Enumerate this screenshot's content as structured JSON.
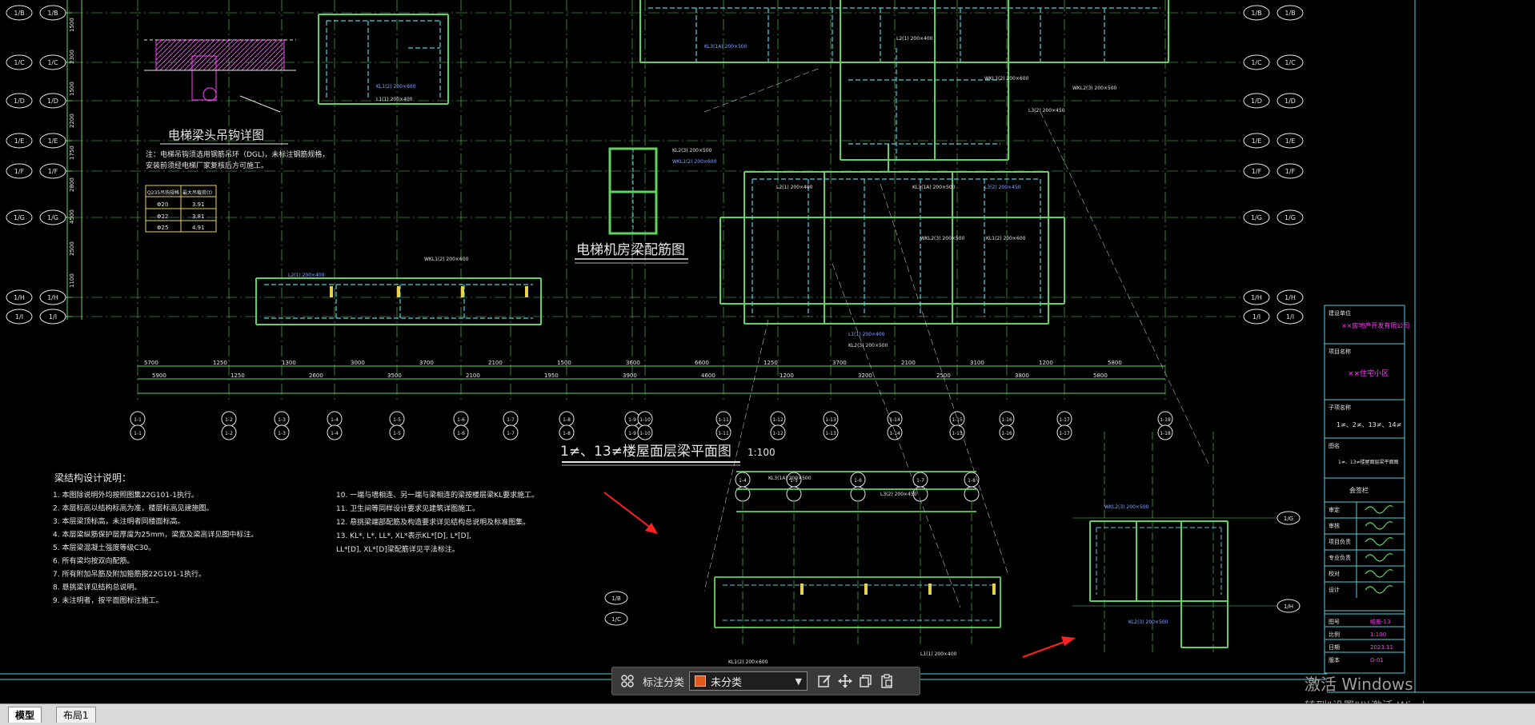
{
  "drawing": {
    "title_main": "1≠、13≠楼屋面层梁平面图",
    "title_scale": "1:100",
    "title_machine_room": "电梯机房梁配筋图",
    "title_elevator_detail": "电梯梁头吊钩详图",
    "note_detail_1": "注：电梯吊钩须选用钢筋吊环（DGL)，未标注钢筋规格，",
    "note_detail_2": "安装前须经电梯厂家复核后方可施工。",
    "rebar_table": {
      "headers": [
        "Q235吊钩规格",
        "最大吊载荷(t)"
      ],
      "rows": [
        [
          "Φ20",
          "3.91"
        ],
        [
          "Φ22",
          "3.81"
        ],
        [
          "Φ25",
          "4.91"
        ]
      ]
    },
    "notes_title": "梁结构设计说明：",
    "notes_left": [
      "1. 本图除说明外均按照图集22G101-1执行。",
      "2. 本层标高以结构标高为准，楼层标高见建施图。",
      "3. 本层梁顶标高，未注明者同楼面标高。",
      "4. 本层梁纵筋保护层厚度为25mm，梁宽及梁高详见图中标注。",
      "5. 本层梁混凝土强度等级C30。",
      "6. 所有梁均按双向配筋。",
      "7. 所有附加吊筋及附加箍筋按22G101-1执行。",
      "8. 悬挑梁详见结构总说明。",
      "9. 未注明者，按平面图标注施工。"
    ],
    "notes_right": [
      "10. 一端与墙相连、另一端与梁相连的梁按楼层梁KL要求施工。",
      "11. 卫生间等同样设计要求见建筑详图施工。",
      "12. 悬挑梁端部配筋及构造要求详见结构总说明及标准图集。",
      "13. KL*, L*, LL*, XL*表示KL*[D], L*[D],",
      "LL*[D], XL*[D]梁配筋详见平法标注。"
    ],
    "grid_right": [
      "1/B",
      "1/C",
      "1/D",
      "1/E",
      "1/F",
      "1/G",
      "1/H",
      "1/I"
    ],
    "grid_bottom": [
      "1-1",
      "1-2",
      "1-3",
      "1-4",
      "1-5",
      "1-6",
      "1-7",
      "1-8",
      "1-9",
      "1-10",
      "1-11",
      "1-12",
      "1-13",
      "1-14",
      "1-15",
      "1-16",
      "1-17",
      "1-18"
    ],
    "dims_bottom_row1": [
      "5700",
      "1250",
      "1300",
      "3000",
      "3700",
      "2100",
      "1500",
      "3600",
      "6600",
      "1250",
      "3700",
      "2100",
      "3100",
      "1200",
      "5800"
    ],
    "dims_bottom_row2": [
      "5900",
      "1250",
      "2600",
      "3500",
      "2100",
      "1950",
      "3900",
      "4600",
      "1200",
      "3200",
      "2500",
      "3800",
      "5800"
    ],
    "dims_left": [
      "1500",
      "2300",
      "1500",
      "2200",
      "1750",
      "2800",
      "4500",
      "2500",
      "1100"
    ],
    "beam_labels": [
      "KL1(2) 200×600",
      "L1(1) 200×400",
      "KL2(3) 200×500",
      "WKL1(2) 200×600",
      "L2(1) 200×400",
      "KL3(1A) 200×500",
      "L3(2) 200×450",
      "WKL2(3) 200×500"
    ]
  },
  "title_block": {
    "company_label": "建设单位",
    "company_value": "××房地产开发有限公司",
    "project_label": "项目名称",
    "project_value": "××住宅小区",
    "sub_label": "子项名称",
    "sub_value": "1≠、2≠、13≠、14≠",
    "drawing_label": "图名",
    "drawing_value": "1≠、13≠楼屋面层梁平面图",
    "sign_label": "会签栏",
    "rows": [
      "审定",
      "审核",
      "项目负责",
      "专业负责",
      "校对",
      "设计"
    ],
    "meta": [
      "图号",
      "比例",
      "日期",
      "版本"
    ],
    "meta_values": [
      "结施-13",
      "1:100",
      "2023.11",
      "G-01"
    ]
  },
  "toolbar": {
    "category_label": "标注分类",
    "category_value": "未分类",
    "icons": [
      "grid-icon",
      "edit-icon",
      "move-icon",
      "copy-icon",
      "paste-icon"
    ]
  },
  "tabs": {
    "model": "模型",
    "layout1": "布局1"
  },
  "watermark": {
    "title": "激活 Windows",
    "subtitle": "转到\"设置\"以激活 Windows。"
  },
  "colors": {
    "green": "#5fd35f",
    "cyan": "#4fd0e0",
    "magenta": "#ff3cff",
    "blue_text": "#8aa8ff",
    "red_arrow": "#ff2020",
    "white": "#e6e6e6"
  }
}
